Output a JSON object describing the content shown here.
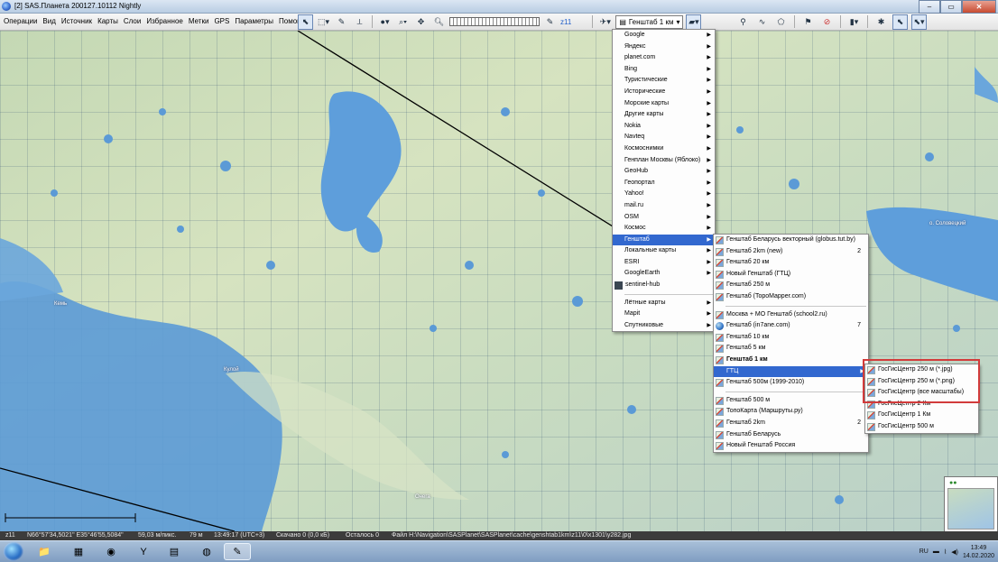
{
  "window": {
    "title": "[2] SAS.Планета 200127.10112 Nightly"
  },
  "menubar": [
    "Операции",
    "Вид",
    "Источник",
    "Карты",
    "Слои",
    "Избранное",
    "Метки",
    "GPS",
    "Параметры",
    "Помощь"
  ],
  "toolbar": {
    "zoom_label": "z11",
    "map_selector": "Генштаб 1 км"
  },
  "map": {
    "labels": [
      "Кулой",
      "о. Соловецкий",
      "Онега",
      "Кемь"
    ]
  },
  "menu_sources": {
    "items": [
      "Google",
      "Яндекс",
      "planet.com",
      "Bing",
      "Туристические",
      "Исторические",
      "Морские карты",
      "Другие карты",
      "Nokia",
      "Navteq",
      "Космоснимки",
      "Генплан Москвы (Яблоко)",
      "GeoHub",
      "Геопортал",
      "Yahoo!",
      "mail.ru",
      "OSM",
      "Космос",
      "Генштаб",
      "Локальные карты",
      "ESRI",
      "GoogleEarth",
      "sentinel-hub"
    ],
    "items2": [
      "Лётные карты",
      "Марit",
      "Спутниковые"
    ],
    "highlighted": "Генштаб"
  },
  "menu_genshtab": {
    "items": [
      {
        "label": "Генштаб Беларусь векторный (globus.tut.by)",
        "count": ""
      },
      {
        "label": "Генштаб 2km (new)",
        "count": "2"
      },
      {
        "label": "Генштаб 20 км",
        "count": ""
      },
      {
        "label": "Новый Генштаб (ГТЦ)",
        "count": ""
      },
      {
        "label": "Генштаб 250 м",
        "count": ""
      },
      {
        "label": "Генштаб (TopoMapper.com)",
        "count": ""
      }
    ],
    "items2": [
      {
        "label": "Москва + МО Генштаб (school2.ru)",
        "count": ""
      },
      {
        "label": "Генштаб (in7ane.com)",
        "count": "7"
      },
      {
        "label": "Генштаб 10 км",
        "count": ""
      },
      {
        "label": "Генштаб 5 км",
        "count": ""
      },
      {
        "label": "Генштаб 1 км",
        "count": ""
      },
      {
        "label": "ГТЦ",
        "count": ""
      },
      {
        "label": "Генштаб 500м (1999-2010)",
        "count": ""
      }
    ],
    "items3": [
      {
        "label": "Генштаб 500 м",
        "count": ""
      },
      {
        "label": "ТопоКарта (Маршруты.ру)",
        "count": ""
      },
      {
        "label": "Генштаб 2km",
        "count": "2"
      },
      {
        "label": "Генштаб Беларусь",
        "count": ""
      },
      {
        "label": "Новый Генштаб Россия",
        "count": ""
      }
    ],
    "highlighted": "ГТЦ",
    "bold": "Генштаб 1 км"
  },
  "menu_gtc": {
    "items": [
      "ГосГисЦентр 250 м (*.jpg)",
      "ГосГисЦентр 250 м (*.png)",
      "ГосГисЦентр (все масштабы)",
      "ГосГисЦентр 2 Км",
      "ГосГисЦентр 1 Км",
      "ГосГисЦентр 500 м"
    ]
  },
  "statusbar": {
    "zoom": "z11",
    "coords": "N66°57'34,5021\" E35°46'55,5084\"",
    "scale": "59,03 м/пикс.",
    "altitude": "79 м",
    "time": "13:49:17 (UTC+3)",
    "downloaded": "Скачано 0 (0,0 кБ)",
    "remaining": "Осталось 0",
    "file": "Файл H:\\Navigation\\SASPlanet\\SASPlanet\\cache\\genshtab1km\\z11\\0\\x1301\\y282.jpg"
  },
  "taskbar": {
    "lang": "RU",
    "time": "13:49",
    "date": "14.02.2020"
  },
  "colors": {
    "highlight": "#3268cf",
    "redbox": "#d23b3b",
    "water": "#7aa7dc"
  }
}
